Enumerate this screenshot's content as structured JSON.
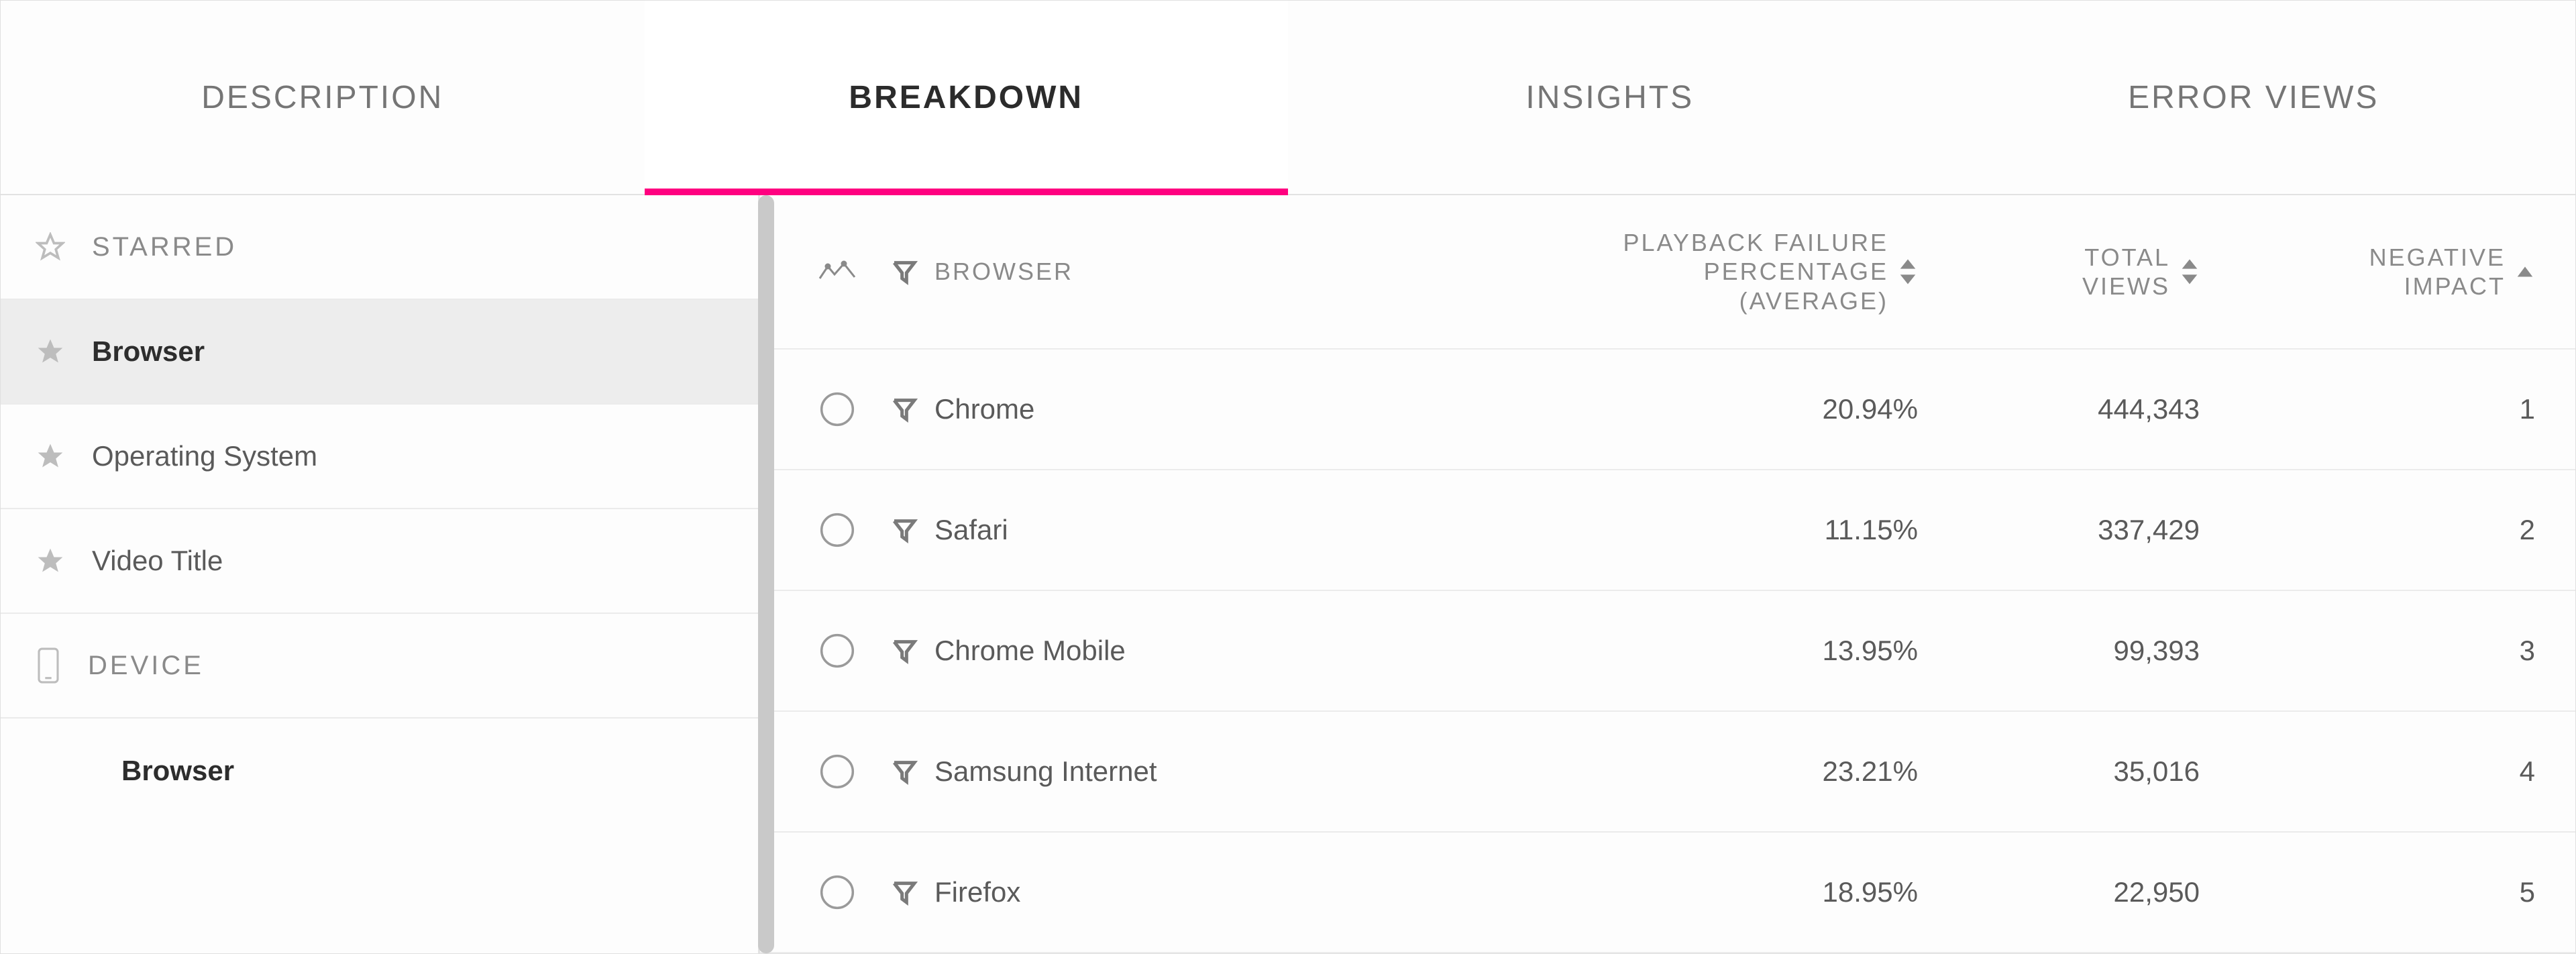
{
  "tabs": [
    {
      "label": "DESCRIPTION",
      "active": false
    },
    {
      "label": "BREAKDOWN",
      "active": true
    },
    {
      "label": "INSIGHTS",
      "active": false
    },
    {
      "label": "ERROR VIEWS",
      "active": false
    }
  ],
  "sidebar": {
    "starred_header": "STARRED",
    "starred_items": [
      {
        "label": "Browser",
        "selected": true
      },
      {
        "label": "Operating System",
        "selected": false
      },
      {
        "label": "Video Title",
        "selected": false
      }
    ],
    "device_header": "DEVICE",
    "device_items": [
      {
        "label": "Browser"
      }
    ]
  },
  "table": {
    "columns": {
      "browser": "BROWSER",
      "pfp_line1": "PLAYBACK FAILURE",
      "pfp_line2": "PERCENTAGE",
      "pfp_line3": "(AVERAGE)",
      "total_views_line1": "TOTAL",
      "total_views_line2": "VIEWS",
      "neg_impact_line1": "NEGATIVE",
      "neg_impact_line2": "IMPACT"
    },
    "rows": [
      {
        "name": "Chrome",
        "pfp": "20.94%",
        "views": "444,343",
        "impact": "1"
      },
      {
        "name": "Safari",
        "pfp": "11.15%",
        "views": "337,429",
        "impact": "2"
      },
      {
        "name": "Chrome Mobile",
        "pfp": "13.95%",
        "views": "99,393",
        "impact": "3"
      },
      {
        "name": "Samsung Internet",
        "pfp": "23.21%",
        "views": "35,016",
        "impact": "4"
      },
      {
        "name": "Firefox",
        "pfp": "18.95%",
        "views": "22,950",
        "impact": "5"
      }
    ]
  }
}
